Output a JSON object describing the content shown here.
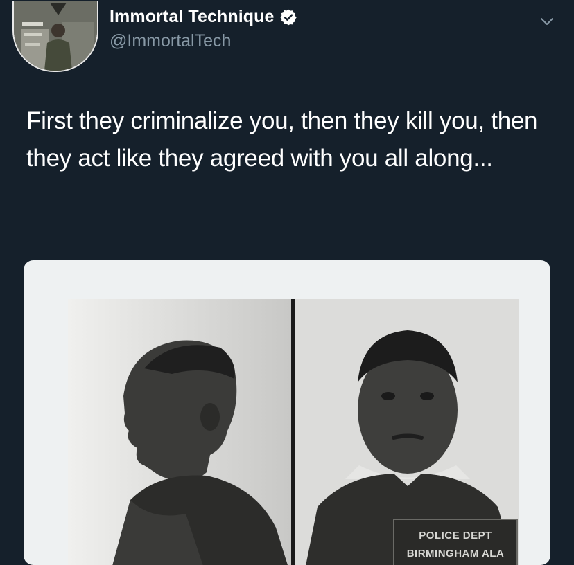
{
  "author": {
    "display_name": "Immortal Technique",
    "handle": "@ImmortalTech",
    "verified": true
  },
  "tweet": {
    "text": "First they criminalize you, then they kill you, then they act like they agreed with you all along..."
  },
  "media": {
    "plaque_line1": "POLICE DEPT",
    "plaque_line2": "BIRMINGHAM ALA"
  },
  "icons": {
    "avatar": "avatar-photo",
    "verified": "verified-badge-icon",
    "menu": "chevron-down-icon"
  },
  "colors": {
    "background": "#15202b",
    "handle": "#8899a6",
    "card": "#eef1f2",
    "verified_badge": "#ffffff"
  }
}
